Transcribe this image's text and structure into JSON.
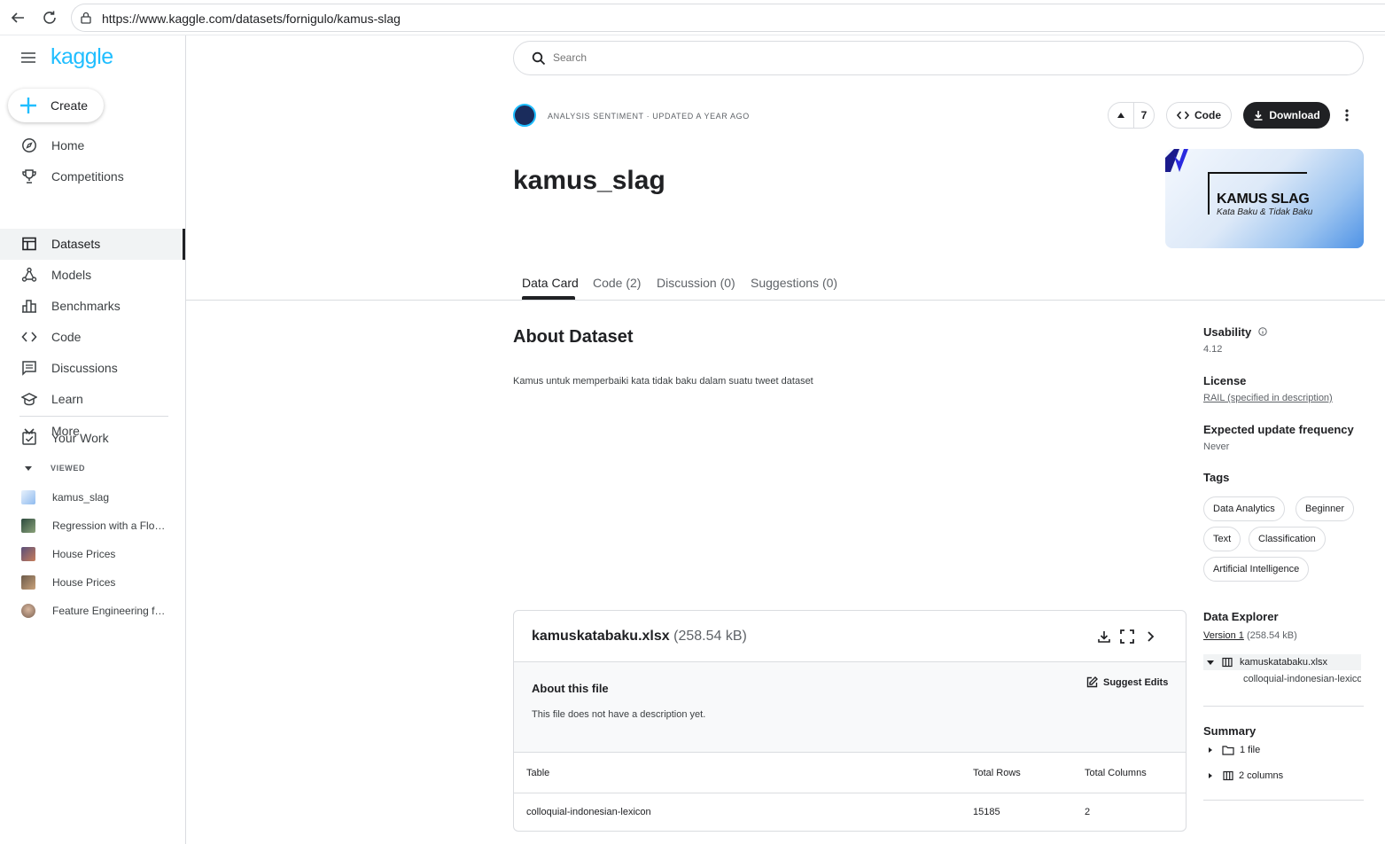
{
  "browser": {
    "url": "https://www.kaggle.com/datasets/fornigulo/kamus-slag"
  },
  "sidebar": {
    "logo": "kaggle",
    "create_label": "Create",
    "items": [
      {
        "label": "Home",
        "icon": "compass-icon"
      },
      {
        "label": "Competitions",
        "icon": "trophy-icon"
      },
      {
        "label": "Datasets",
        "icon": "table-icon",
        "active": true
      },
      {
        "label": "Models",
        "icon": "models-icon"
      },
      {
        "label": "Benchmarks",
        "icon": "bar-chart-icon"
      },
      {
        "label": "Code",
        "icon": "code-icon"
      },
      {
        "label": "Discussions",
        "icon": "comment-icon"
      },
      {
        "label": "Learn",
        "icon": "school-icon"
      },
      {
        "label": "More",
        "icon": "chevron-down-icon"
      }
    ],
    "your_work": "Your Work",
    "viewed_label": "VIEWED",
    "viewed": [
      {
        "label": "kamus_slag"
      },
      {
        "label": "Regression with a Flood Prediction Dataset"
      },
      {
        "label": "House Prices"
      },
      {
        "label": "House Prices"
      },
      {
        "label": "Feature Engineering for House Prices"
      }
    ]
  },
  "search": {
    "placeholder": "Search"
  },
  "header": {
    "meta": "ANALYSIS SENTIMENT · UPDATED A YEAR AGO",
    "vote_count": "7",
    "code_label": "Code",
    "download_label": "Download",
    "title": "kamus_slag",
    "banner_title": "KAMUS SLAG",
    "banner_subtitle": "Kata Baku & Tidak Baku"
  },
  "tabs": [
    {
      "label": "Data Card",
      "active": true
    },
    {
      "label": "Code (2)"
    },
    {
      "label": "Discussion (0)"
    },
    {
      "label": "Suggestions (0)"
    }
  ],
  "about": {
    "heading": "About Dataset",
    "description": "Kamus untuk memperbaiki kata tidak baku dalam suatu tweet dataset"
  },
  "file": {
    "name": "kamuskatabaku.xlsx",
    "size": "(258.54 kB)",
    "about_heading": "About this file",
    "about_text": "This file does not have a description yet.",
    "suggest_label": "Suggest Edits",
    "table": {
      "headers": [
        "Table",
        "Total Rows",
        "Total Columns"
      ],
      "rows": [
        [
          "colloquial-indonesian-lexicon",
          "15185",
          "2"
        ]
      ]
    }
  },
  "right": {
    "usability_label": "Usability",
    "usability_value": "4.12",
    "license_label": "License",
    "license_value": "RAIL (specified in description)",
    "frequency_label": "Expected update frequency",
    "frequency_value": "Never",
    "tags_label": "Tags",
    "tags": [
      "Data Analytics",
      "Beginner",
      "Text",
      "Classification",
      "Artificial Intelligence"
    ],
    "explorer_label": "Data Explorer",
    "version_link": "Version 1",
    "version_size": "(258.54 kB)",
    "tree_file": "kamuskatabaku.xlsx",
    "tree_sheet": "colloquial-indonesian-lexicon",
    "summary_label": "Summary",
    "summary_files": "1 file",
    "summary_columns": "2 columns"
  }
}
